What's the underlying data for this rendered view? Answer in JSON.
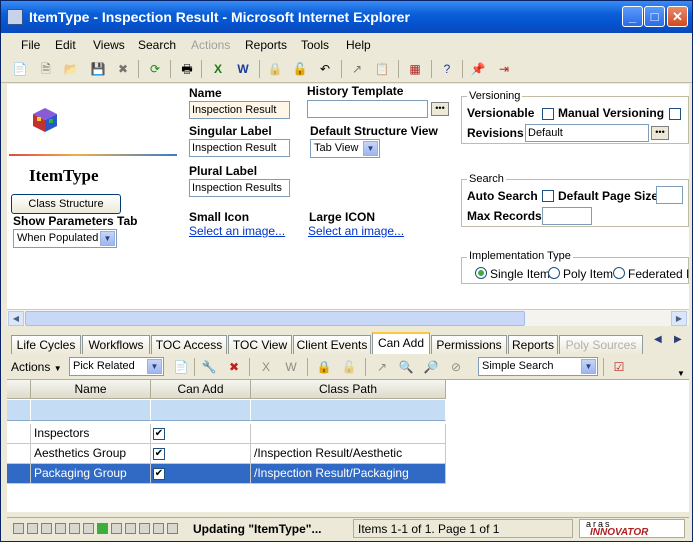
{
  "window": {
    "title": "ItemType - Inspection Result - Microsoft Internet Explorer"
  },
  "menu": [
    "File",
    "Edit",
    "Views",
    "Search",
    "Actions",
    "Reports",
    "Tools",
    "Help"
  ],
  "form": {
    "item_type_label": "ItemType",
    "class_structure_button": "Class Structure",
    "show_parameters_tab_label": "Show Parameters Tab",
    "show_parameters_tab_value": "When Populated",
    "name_label": "Name",
    "name_value": "Inspection Result",
    "singular_label": "Singular Label",
    "singular_value": "Inspection Result",
    "plural_label": "Plural Label",
    "plural_value": "Inspection Results",
    "small_icon_label": "Small Icon",
    "small_icon_link": "Select an image...",
    "history_template_label": "History Template",
    "history_template_value": "",
    "default_structure_view_label": "Default Structure View",
    "default_structure_view_value": "Tab View",
    "large_icon_label": "Large ICON",
    "large_icon_link": "Select an image...",
    "versioning": {
      "title": "Versioning",
      "versionable_label": "Versionable",
      "manual_versioning_label": "Manual Versioning",
      "revisions_label": "Revisions",
      "revisions_value": "Default"
    },
    "search": {
      "title": "Search",
      "auto_search_label": "Auto Search",
      "default_page_size_label": "Default Page Size",
      "max_records_label": "Max Records"
    },
    "implementation": {
      "title": "Implementation Type",
      "options": [
        "Single Item",
        "Poly Item",
        "Federated It"
      ],
      "selected": "Single Item"
    }
  },
  "tabs": [
    {
      "label": "Life Cycles",
      "state": "normal"
    },
    {
      "label": "Workflows",
      "state": "normal"
    },
    {
      "label": "TOC Access",
      "state": "normal"
    },
    {
      "label": "TOC View",
      "state": "normal"
    },
    {
      "label": "Client Events",
      "state": "normal"
    },
    {
      "label": "Can Add",
      "state": "active"
    },
    {
      "label": "Permissions",
      "state": "normal"
    },
    {
      "label": "Reports",
      "state": "normal"
    },
    {
      "label": "Poly Sources",
      "state": "disabled"
    }
  ],
  "grid_toolbar": {
    "actions_label": "Actions",
    "pick_related_value": "Pick Related",
    "search_mode_value": "Simple Search"
  },
  "grid": {
    "columns": [
      "Name",
      "Can Add",
      "Class Path"
    ],
    "rows": [
      {
        "name": "Inspectors",
        "can_add": true,
        "class_path": ""
      },
      {
        "name": "Aesthetics Group",
        "can_add": true,
        "class_path": "/Inspection Result/Aesthetic"
      },
      {
        "name": "Packaging Group",
        "can_add": true,
        "class_path": "/Inspection Result/Packaging",
        "selected": true
      }
    ]
  },
  "status": {
    "progress": 0.4,
    "message": "Updating \"ItemType\"...",
    "paging": "Items 1-1 of 1. Page 1 of 1",
    "brand_top": "aras",
    "brand": "INNOVATOR"
  },
  "colors": {
    "title_bar": "#0a5fd8",
    "selection": "#316ac5",
    "link": "#0033cc",
    "active_tab_accent": "#ffc83c"
  }
}
